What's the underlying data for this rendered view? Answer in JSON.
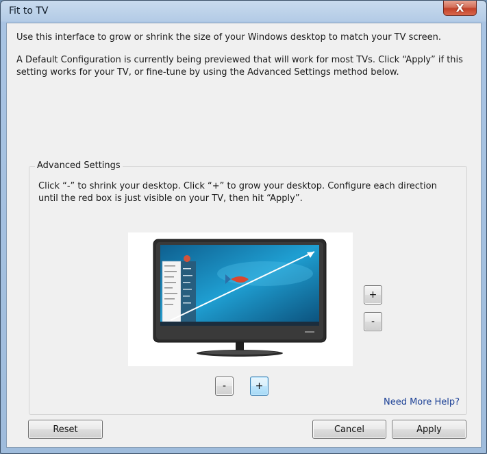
{
  "window": {
    "title": "Fit to TV",
    "close_glyph": "X"
  },
  "intro": {
    "paragraph1": "Use this interface to grow or shrink the size of your Windows desktop to match your TV screen.",
    "paragraph2": "A Default Configuration is currently being previewed that will work for most TVs. Click “Apply” if this setting works for your TV, or fine-tune by using the Advanced Settings method below."
  },
  "advanced": {
    "legend": "Advanced Settings",
    "description": "Click “-” to shrink  your desktop. Click “+” to grow your desktop. Configure each direction until the red box is just visible on your TV, then hit “Apply”.",
    "vertical_grow_label": "+",
    "vertical_shrink_label": "-",
    "horizontal_shrink_label": "-",
    "horizontal_grow_label": "+",
    "help_link": "Need More Help?"
  },
  "footer": {
    "reset_label": "Reset",
    "cancel_label": "Cancel",
    "apply_label": "Apply"
  },
  "colors": {
    "tv_bezel": "#2c2c2c",
    "screen_blue": "#1c86b8",
    "link_blue": "#1a3f95"
  }
}
